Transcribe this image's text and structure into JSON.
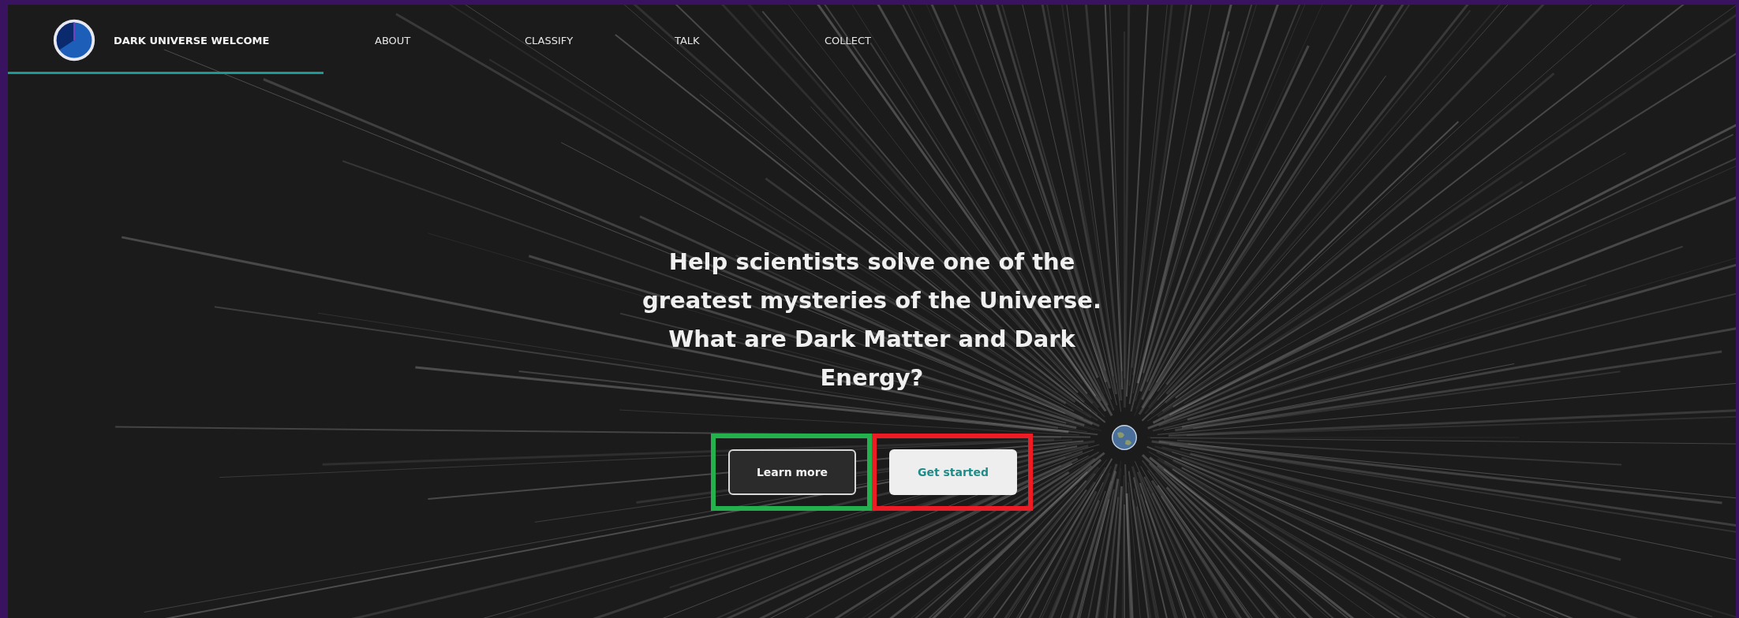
{
  "header": {
    "title": "DARK UNIVERSE WELCOME",
    "active_underline": true,
    "nav": [
      {
        "label": "ABOUT"
      },
      {
        "label": "CLASSIFY"
      },
      {
        "label": "TALK"
      },
      {
        "label": "COLLECT"
      }
    ]
  },
  "hero": {
    "headline": "Help scientists solve one of the greatest mysteries of the Universe. What are Dark Matter and Dark Energy?",
    "buttons": [
      {
        "label": "Learn more",
        "kind": "outline",
        "color": "#22b14c"
      },
      {
        "label": "Get started",
        "kind": "filled",
        "color": "#ed1c24"
      }
    ]
  }
}
